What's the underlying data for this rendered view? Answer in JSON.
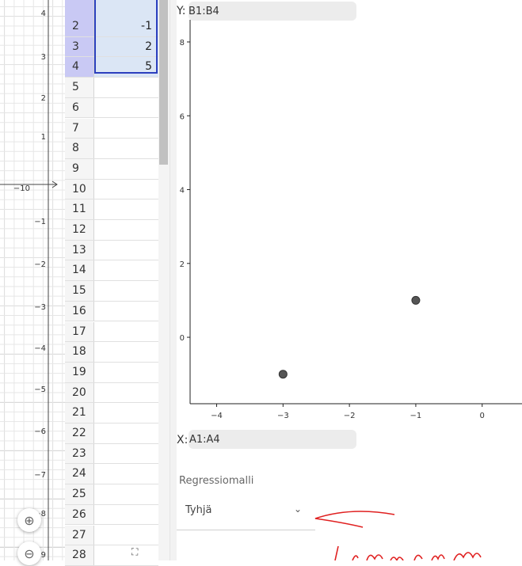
{
  "graphics_view": {
    "y_ticks": [
      "4",
      "3",
      "2",
      "1",
      "−10",
      "−1",
      "−2",
      "−3",
      "−4",
      "−5",
      "−6",
      "−7",
      "−8",
      "−9"
    ],
    "zoom_in_icon": "zoom-in-icon",
    "zoom_out_icon": "zoom-out-icon"
  },
  "spreadsheet": {
    "rows": [
      {
        "num": "2",
        "b": "-1",
        "selected": true
      },
      {
        "num": "3",
        "b": "2",
        "selected": true
      },
      {
        "num": "4",
        "b": "5",
        "selected": true
      },
      {
        "num": "5",
        "b": ""
      },
      {
        "num": "6",
        "b": ""
      },
      {
        "num": "7",
        "b": ""
      },
      {
        "num": "8",
        "b": ""
      },
      {
        "num": "9",
        "b": ""
      },
      {
        "num": "10",
        "b": ""
      },
      {
        "num": "11",
        "b": ""
      },
      {
        "num": "12",
        "b": ""
      },
      {
        "num": "13",
        "b": ""
      },
      {
        "num": "14",
        "b": ""
      },
      {
        "num": "15",
        "b": ""
      },
      {
        "num": "16",
        "b": ""
      },
      {
        "num": "17",
        "b": ""
      },
      {
        "num": "18",
        "b": ""
      },
      {
        "num": "19",
        "b": ""
      },
      {
        "num": "20",
        "b": ""
      },
      {
        "num": "21",
        "b": ""
      },
      {
        "num": "22",
        "b": ""
      },
      {
        "num": "23",
        "b": ""
      },
      {
        "num": "24",
        "b": ""
      },
      {
        "num": "25",
        "b": ""
      },
      {
        "num": "26",
        "b": ""
      },
      {
        "num": "27",
        "b": ""
      },
      {
        "num": "28",
        "b": ""
      }
    ]
  },
  "regression_panel": {
    "y_label": "Y:",
    "y_value": "B1:B4",
    "x_label": "X:",
    "x_value": "A1:A4",
    "model_label": "Regressiomalli",
    "model_value": "Tyhjä",
    "chart_data": {
      "type": "scatter",
      "x_ticks": [
        "−4",
        "−3",
        "−2",
        "−1",
        "0"
      ],
      "y_ticks": [
        "8",
        "6",
        "4",
        "2",
        "0"
      ],
      "xlim": [
        -4.4,
        0.6
      ],
      "ylim": [
        -1.8,
        8.6
      ],
      "points": [
        {
          "x": -3,
          "y": -1
        },
        {
          "x": -1,
          "y": 1
        }
      ],
      "point_color": "#555555"
    }
  },
  "annotation": {
    "color": "#e02020"
  }
}
